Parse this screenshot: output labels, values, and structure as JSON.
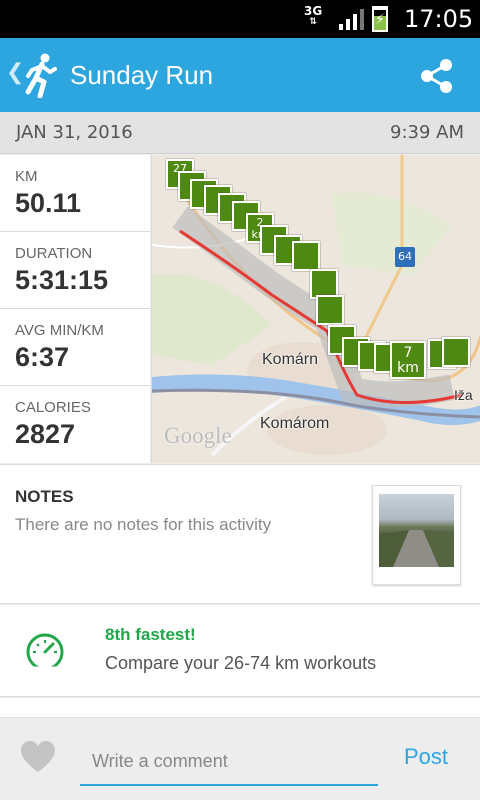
{
  "status_bar": {
    "network": "3G",
    "time": "17:05"
  },
  "header": {
    "title": "Sunday Run",
    "icons": [
      "back-chevron-icon",
      "runner-icon",
      "share-icon"
    ]
  },
  "activity": {
    "date": "JAN 31, 2016",
    "time": "9:39 AM"
  },
  "stats": [
    {
      "label": "KM",
      "value": "50.11"
    },
    {
      "label": "DURATION",
      "value": "5:31:15"
    },
    {
      "label": "AVG MIN/KM",
      "value": "6:37"
    },
    {
      "label": "CALORIES",
      "value": "2827"
    }
  ],
  "map": {
    "labels": {
      "town_upper": "Komárn",
      "town_lower": "Komárom",
      "town_right": "Iža",
      "road": "64",
      "provider": "Google"
    },
    "markers": [
      "27",
      "2 km",
      "7 km"
    ],
    "route_color": "#e53935",
    "marker_color": "#4e8a12"
  },
  "notes": {
    "title": "NOTES",
    "text": "There are no notes for this activity"
  },
  "achievement": {
    "title": "8th fastest!",
    "subtitle": "Compare your 26-74 km workouts",
    "color": "#22a64a"
  },
  "comment": {
    "placeholder": "Write a comment",
    "post_label": "Post"
  },
  "colors": {
    "accent": "#2da6e0",
    "app_bar": "#2da6e0"
  }
}
